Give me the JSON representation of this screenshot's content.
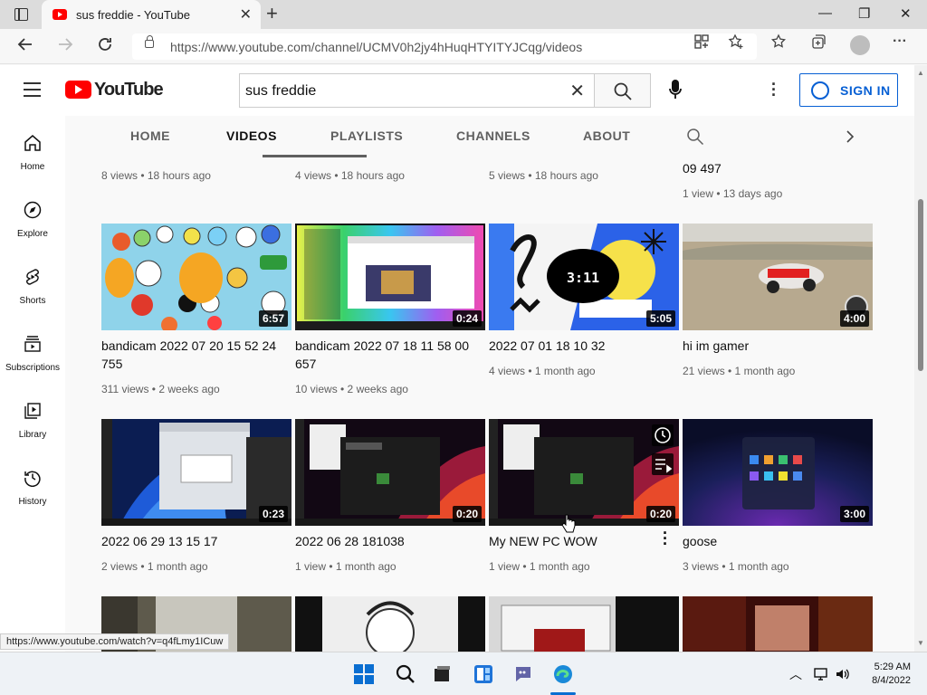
{
  "browser": {
    "tab_title": "sus freddie - YouTube",
    "url": "https://www.youtube.com/channel/UCMV0h2jy4hHuqHTYITYJCqg/videos",
    "status_link": "https://www.youtube.com/watch?v=q4fLmy1ICuw"
  },
  "youtube": {
    "wordmark": "YouTube",
    "search_value": "sus freddie",
    "sign_in_label": "SIGN IN"
  },
  "left_nav": [
    {
      "label": "Home"
    },
    {
      "label": "Explore"
    },
    {
      "label": "Shorts"
    },
    {
      "label": "Subscriptions"
    },
    {
      "label": "Library"
    },
    {
      "label": "History"
    }
  ],
  "channel_tabs": [
    "HOME",
    "VIDEOS",
    "PLAYLISTS",
    "CHANNELS",
    "ABOUT"
  ],
  "partial_row": [
    {
      "meta": "8 views • 18 hours ago"
    },
    {
      "meta": "4 views • 18 hours ago"
    },
    {
      "meta": "5 views • 18 hours ago"
    },
    {
      "title_tail": "09 497",
      "meta": "1 view • 13 days ago"
    }
  ],
  "videos_row1": [
    {
      "title": "bandicam 2022 07 20 15 52 24 755",
      "meta": "311 views • 2 weeks ago",
      "duration": "6:57"
    },
    {
      "title": "bandicam 2022 07 18 11 58 00 657",
      "meta": "10 views • 2 weeks ago",
      "duration": "0:24"
    },
    {
      "title": "2022 07 01 18 10 32",
      "meta": "4 views • 1 month ago",
      "duration": "5:05",
      "thumb_text": "3:11"
    },
    {
      "title": "hi im gamer",
      "meta": "21 views • 1 month ago",
      "duration": "4:00"
    }
  ],
  "videos_row2": [
    {
      "title": "2022 06 29 13 15 17",
      "meta": "2 views • 1 month ago",
      "duration": "0:23"
    },
    {
      "title": "2022 06 28 181038",
      "meta": "1 view • 1 month ago",
      "duration": "0:20"
    },
    {
      "title": "My NEW PC WOW",
      "meta": "1 view • 1 month ago",
      "duration": "0:20"
    },
    {
      "title": "goose",
      "meta": "3 views • 1 month ago",
      "duration": "3:00"
    }
  ],
  "taskbar": {
    "time": "5:29 AM",
    "date": "8/4/2022"
  },
  "colors": {
    "youtube_red": "#ff0000",
    "link_blue": "#065fd4"
  }
}
